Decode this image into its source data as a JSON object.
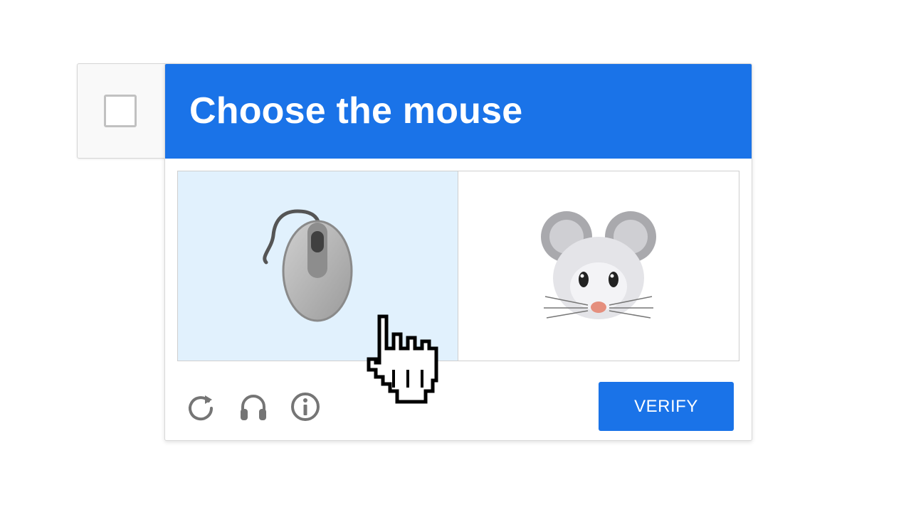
{
  "challenge": {
    "title": "Choose the mouse",
    "options": [
      {
        "icon": "computer-mouse-icon",
        "selected": true
      },
      {
        "icon": "mouse-face-icon",
        "selected": false
      }
    ]
  },
  "footer": {
    "icons": [
      "reload-icon",
      "headphones-icon",
      "info-icon"
    ],
    "verify_label": "VERIFY"
  },
  "colors": {
    "accent": "#1a73e8",
    "selected_tile": "#e1f1fd",
    "footer_icon": "#757575"
  }
}
